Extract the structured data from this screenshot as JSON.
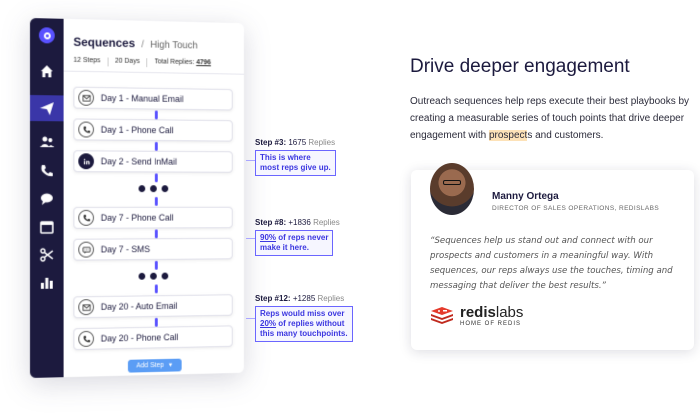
{
  "app": {
    "sidebar_icons": [
      "home-icon",
      "send-icon",
      "users-icon",
      "phone-icon",
      "chat-icon",
      "calendar-icon",
      "scissors-icon",
      "bar-chart-icon"
    ],
    "header": {
      "title": "Sequences",
      "separator": "/",
      "subtitle": "High Touch"
    },
    "stats": {
      "steps": "12 Steps",
      "days": "20 Days",
      "replies_label": "Total Replies:",
      "replies_value": "4796"
    },
    "steps": [
      {
        "icon": "email-icon",
        "label": "Day 1 - Manual Email"
      },
      {
        "icon": "phone-icon",
        "label": "Day 1 - Phone Call"
      },
      {
        "icon": "linkedin-icon",
        "label": "Day 2 - Send InMail"
      },
      {
        "icon": "phone-icon",
        "label": "Day 7 - Phone Call"
      },
      {
        "icon": "sms-icon",
        "label": "Day 7 - SMS"
      },
      {
        "icon": "email-icon",
        "label": "Day 20 - Auto Email"
      },
      {
        "icon": "phone-icon",
        "label": "Day 20 - Phone Call"
      }
    ],
    "add_step_label": "Add Step",
    "accent": "#5951FF",
    "rail_color": "#1C1A3E"
  },
  "callouts": [
    {
      "title": "Step #3:",
      "count": "1675",
      "suffix": "Replies",
      "lines": [
        "This is where",
        "most reps give up."
      ]
    },
    {
      "title": "Step #8:",
      "count": "+1836",
      "suffix": "Replies",
      "lines": [
        "90% of reps never",
        "make it here."
      ],
      "underline": "90%"
    },
    {
      "title": "Step #12:",
      "count": "+1285",
      "suffix": "Replies",
      "lines": [
        "Reps would miss over",
        "20% of replies without",
        "this many touchpoints."
      ],
      "underline": "20%"
    }
  ],
  "right": {
    "heading": "Drive deeper engagement",
    "body_before": "Outreach sequences help reps execute their best playbooks by creating a measurable series of touch points that drive deeper engagement with ",
    "body_highlight": "prospect",
    "body_after": "s and customers.",
    "testimonial": {
      "name": "Manny Ortega",
      "title": "DIRECTOR OF SALES OPERATIONS, REDISLABS",
      "quote": "“Sequences help us stand out and connect with our prospects and customers in a meaningful way. With sequences, our reps always use the touches, timing and messaging that deliver the best results.”",
      "logo_bold": "redis",
      "logo_light": "labs",
      "logo_tagline": "HOME OF REDIS"
    }
  }
}
